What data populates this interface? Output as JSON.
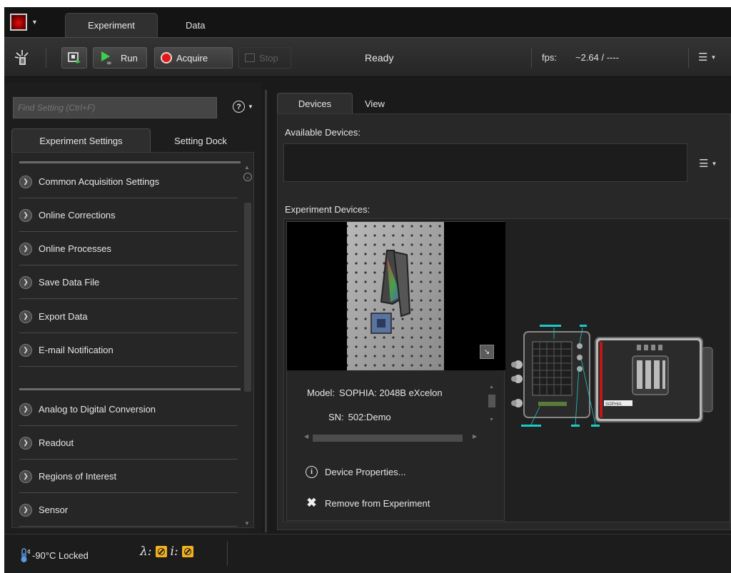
{
  "app": {
    "tabs": [
      {
        "label": "Experiment",
        "active": true
      },
      {
        "label": "Data",
        "active": false
      }
    ],
    "accent_color": "#d01515"
  },
  "toolbar": {
    "preview_icon": "preview-icon",
    "run_label": "Run",
    "acquire_label": "Acquire",
    "stop_label": "Stop",
    "status": "Ready",
    "fps_label": "fps:",
    "fps_value": "~2.64 / ----"
  },
  "left": {
    "find_placeholder": "Find Setting (Ctrl+F)",
    "tabs": [
      {
        "label": "Experiment Settings",
        "active": true
      },
      {
        "label": "Setting Dock",
        "active": false
      }
    ],
    "sections_top": [
      "Common Acquisition Settings",
      "Online Corrections",
      "Online Processes",
      "Save Data File",
      "Export Data",
      "E-mail Notification"
    ],
    "sections_bottom": [
      "Analog to Digital Conversion",
      "Readout",
      "Regions of Interest",
      "Sensor"
    ]
  },
  "right": {
    "tabs": [
      {
        "label": "Devices",
        "active": true
      },
      {
        "label": "View",
        "active": false
      }
    ],
    "available_label": "Available Devices:",
    "experiment_label": "Experiment Devices:",
    "device": {
      "model_key": "Model:",
      "model_value": "SOPHIA: 2048B eXcelon",
      "sn_key": "SN:",
      "sn_value": "502:Demo",
      "properties_label": "Device Properties...",
      "remove_label": "Remove from Experiment",
      "camera_brand": "SOPHIA"
    }
  },
  "status": {
    "temperature": "-90°C Locked",
    "lambda_label": "λ:",
    "i_label": "i:",
    "warning_color": "#f0b020"
  }
}
